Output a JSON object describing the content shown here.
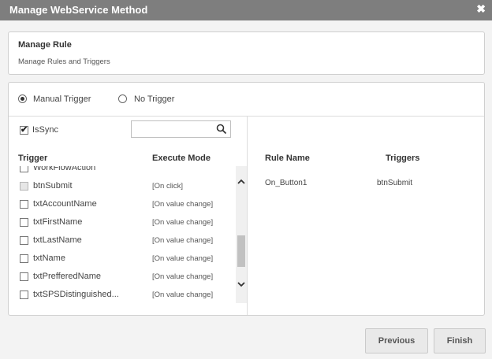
{
  "window": {
    "title": "Manage WebService Method",
    "close_glyph": "✖"
  },
  "rule_panel": {
    "heading": "Manage Rule",
    "subtitle": "Manage Rules and Triggers"
  },
  "trigger_options": {
    "manual_label": "Manual Trigger",
    "none_label": "No Trigger",
    "selected": "Manual Trigger"
  },
  "issync": {
    "label": "IsSync",
    "checked": true
  },
  "search": {
    "placeholder": "",
    "value": ""
  },
  "trigger_table": {
    "col_trigger": "Trigger",
    "col_mode": "Execute Mode",
    "rows": [
      {
        "name": "WorkFlowAction",
        "mode": ""
      },
      {
        "name": "btnSubmit",
        "mode": "[On click]"
      },
      {
        "name": "txtAccountName",
        "mode": "[On value change]"
      },
      {
        "name": "txtFirstName",
        "mode": "[On value change]"
      },
      {
        "name": "txtLastName",
        "mode": "[On value change]"
      },
      {
        "name": "txtName",
        "mode": "[On value change]"
      },
      {
        "name": "txtPrefferedName",
        "mode": "[On value change]"
      },
      {
        "name": "txtSPSDistinguished...",
        "mode": "[On value change]"
      }
    ]
  },
  "rule_table": {
    "col_rule": "Rule Name",
    "col_triggers": "Triggers",
    "rows": [
      {
        "rule": "On_Button1",
        "triggers": "btnSubmit"
      }
    ]
  },
  "buttons": {
    "previous": "Previous",
    "finish": "Finish"
  },
  "icons": {
    "close": "close-icon",
    "search": "search-icon",
    "scroll_up": "chevron-up-icon",
    "scroll_down": "chevron-down-icon"
  },
  "colors": {
    "titlebar": "#7e7e7e",
    "background": "#f3f3f3"
  }
}
